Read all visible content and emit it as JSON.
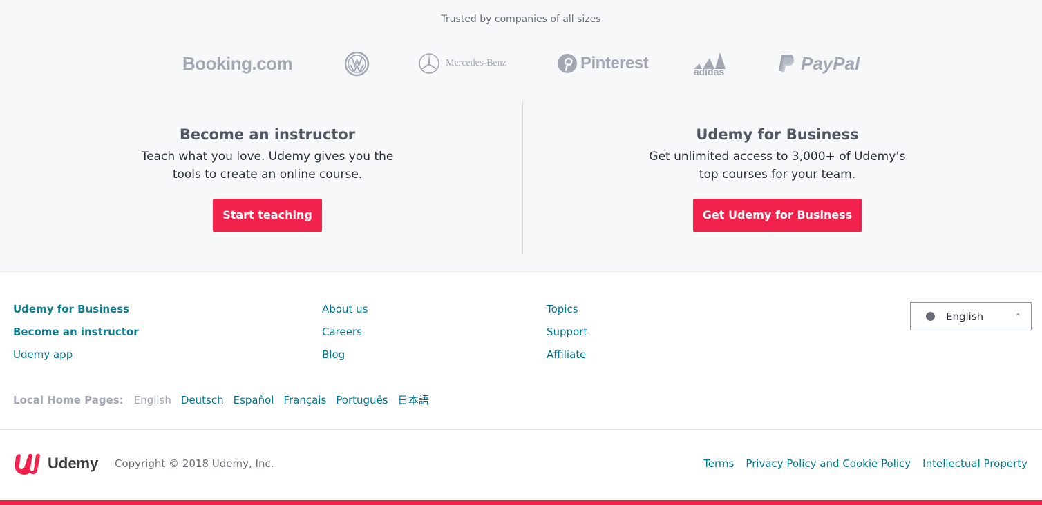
{
  "trusted": {
    "heading": "Trusted by companies of all sizes"
  },
  "logos": {
    "booking": "Booking.com",
    "mercedes": "Mercedes-Benz",
    "pinterest": "Pinterest",
    "adidas": "adidas",
    "paypal": "PayPal"
  },
  "instructor": {
    "title": "Become an instructor",
    "line1": "Teach what you love. Udemy gives you the",
    "line2": "tools to create an online course.",
    "button": "Start teaching"
  },
  "business": {
    "title": "Udemy for Business",
    "line1": "Get unlimited access to 3,000+ of Udemy’s",
    "line2": "top courses for your team.",
    "button": "Get Udemy for Business"
  },
  "footer": {
    "col1": [
      "Udemy for Business",
      "Become an instructor",
      "Udemy app"
    ],
    "col2": [
      "About us",
      "Careers",
      "Blog"
    ],
    "col3": [
      "Topics",
      "Support",
      "Affiliate"
    ],
    "language_select": "English"
  },
  "local_home": {
    "label": "Local Home Pages:",
    "current": "English",
    "languages": [
      "Deutsch",
      "Español",
      "Français",
      "Português",
      "日本語"
    ]
  },
  "bottom": {
    "brand": "Udemy",
    "copyright": "Copyright © 2018 Udemy, Inc.",
    "legal": [
      "Terms",
      "Privacy Policy and Cookie Policy",
      "Intellectual Property"
    ]
  },
  "colors": {
    "accent": "#f0214a",
    "link": "#007791",
    "logo_gray": "#a1a7b3"
  }
}
